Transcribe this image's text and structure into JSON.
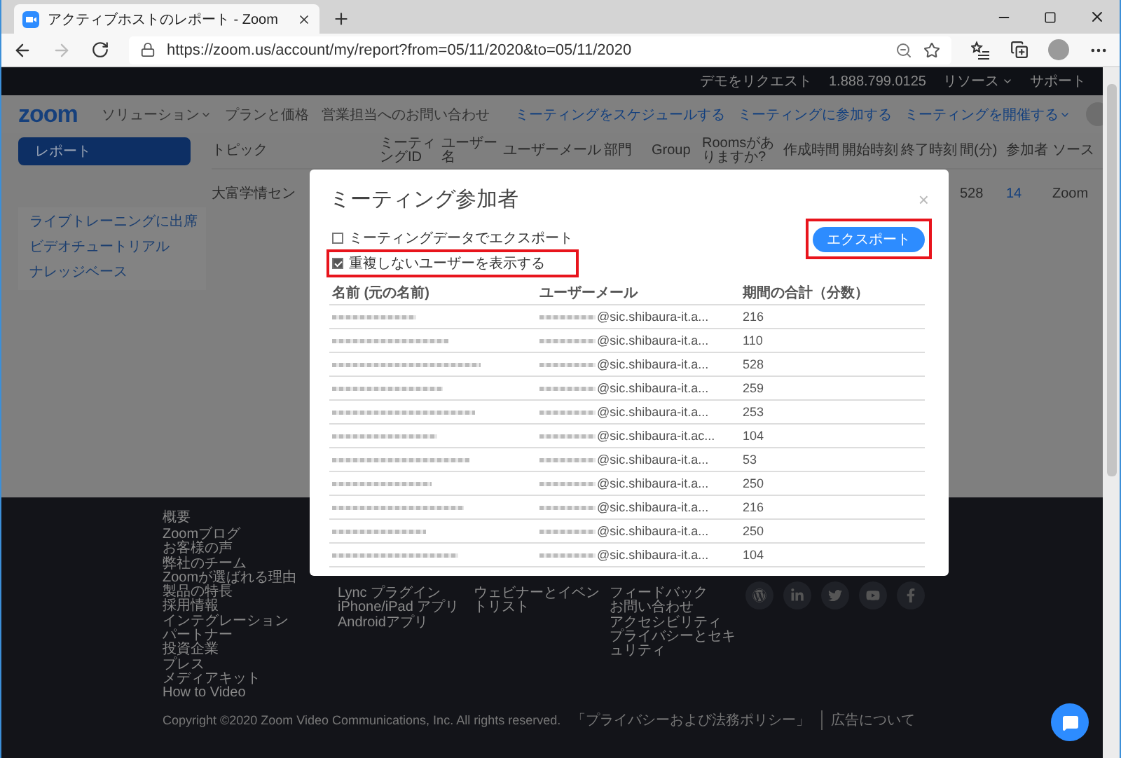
{
  "browser": {
    "tab_title": "アクティブホストのレポート - Zoom",
    "url": "https://zoom.us/account/my/report?from=05/11/2020&to=05/11/2020",
    "forward_disabled": true
  },
  "top_bar": {
    "links": [
      {
        "label": "デモをリクエスト",
        "has_menu": false
      },
      {
        "label": "1.888.799.0125",
        "has_menu": false
      },
      {
        "label": "リソース",
        "has_menu": true
      },
      {
        "label": "サポート",
        "has_menu": false
      }
    ]
  },
  "nav": {
    "logo": "zoom",
    "links": [
      {
        "label": "ソリューション",
        "has_menu": true
      },
      {
        "label": "プランと価格",
        "has_menu": false
      },
      {
        "label": "営業担当へのお問い合わせ",
        "has_menu": false
      }
    ],
    "actions": [
      {
        "label": "ミーティングをスケジュールする",
        "has_menu": false
      },
      {
        "label": "ミーティングに参加する",
        "has_menu": false
      },
      {
        "label": "ミーティングを開催する",
        "has_menu": true
      }
    ]
  },
  "sidebar": {
    "items": [
      {
        "label": "レポート",
        "selected": true
      }
    ],
    "help_links": [
      "ライブトレーニングに出席",
      "ビデオチュートリアル",
      "ナレッジベース"
    ]
  },
  "report_table": {
    "columns": [
      "トピック",
      "ミーティングID",
      "ユーザー名",
      "ユーザーメール",
      "部門",
      "Group",
      "Roomsがありますか?",
      "作成時間",
      "開始時刻",
      "終了時刻",
      "間(分)",
      "参加者",
      "ソース"
    ],
    "rows": [
      {
        "topic": "大富学情セン",
        "duration": "528",
        "participants": "14",
        "source": "Zoom"
      }
    ]
  },
  "modal": {
    "title": "ミーティング参加者",
    "close": "×",
    "options": [
      {
        "label": "ミーティングデータでエクスポート",
        "checked": false,
        "highlighted": false
      },
      {
        "label": "重複しないユーザーを表示する",
        "checked": true,
        "highlighted": true
      }
    ],
    "export_button": {
      "label": "エクスポート",
      "highlighted": true
    },
    "columns": [
      "名前 (元の名前)",
      "ユーザーメール",
      "期間の合計（分数）"
    ],
    "rows": [
      {
        "email": "@sic.shibaura-it.a...",
        "total": "216"
      },
      {
        "email": "@sic.shibaura-it.a...",
        "total": "110"
      },
      {
        "email": "@sic.shibaura-it.a...",
        "total": "528"
      },
      {
        "email": "@sic.shibaura-it.a...",
        "total": "259"
      },
      {
        "email": "@sic.shibaura-it.a...",
        "total": "253"
      },
      {
        "email": "@sic.shibaura-it.ac...",
        "total": "104"
      },
      {
        "email": "@sic.shibaura-it.a...",
        "total": "53"
      },
      {
        "email": "@sic.shibaura-it.a...",
        "total": "250"
      },
      {
        "email": "@sic.shibaura-it.a...",
        "total": "216"
      },
      {
        "email": "@sic.shibaura-it.a...",
        "total": "250"
      },
      {
        "email": "@sic.shibaura-it.a...",
        "total": "104"
      }
    ]
  },
  "footer": {
    "columns": [
      {
        "heading": "概要",
        "links": [
          "Zoomブログ",
          "お客様の声",
          "弊社のチーム",
          "Zoomが選ばれる理由",
          "製品の特長",
          "採用情報",
          "インテグレーション",
          "パートナー",
          "投資企業",
          "プレス",
          "メディアキット",
          "How to Video"
        ]
      },
      {
        "links": [
          "Lync プラグイン",
          "iPhone/iPad アプリ",
          "Androidアプリ"
        ]
      },
      {
        "links": [
          "ウェビナーとイベントリスト"
        ]
      },
      {
        "links": [
          "フィードバック",
          "お問い合わせ",
          "アクセシビリティ",
          "プライバシーとセキュリティ"
        ]
      }
    ],
    "copyright": "Copyright ©2020 Zoom Video Communications, Inc. All rights reserved.",
    "legal_links": [
      "「プライバシーおよび法務ポリシー」",
      "広告について"
    ]
  }
}
